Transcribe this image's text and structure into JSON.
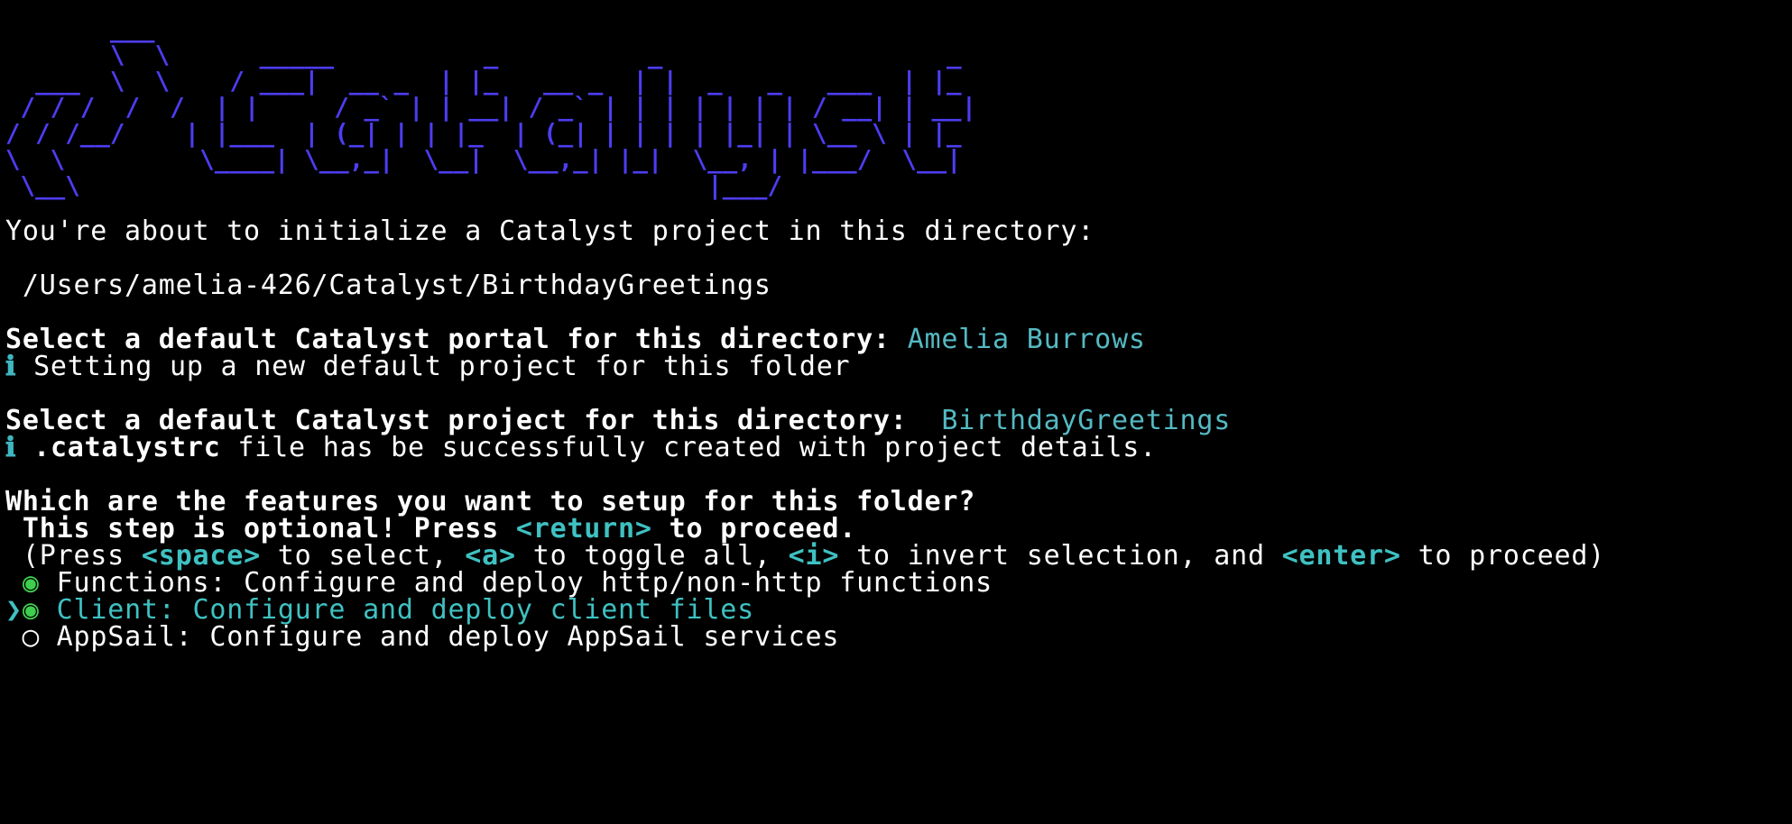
{
  "banner": {
    "art": "       ___\n       \\  \\      _____          _          _                   _\n  ___  \\  \\    / ___|  __ _  | |_   __ _  | |  _   _   ___  | |_\n / / /  /  /  | |     / _` | | __| / _` | | | | | | | / __| | __|\n/ / /__/    | |___  | (_| | | |_  | (_| | | | | |_| | \\__ \\ | |_\n\\  \\         \\____| \\__,_|  \\__|  \\__,_| |_|  \\__, | |___/  \\__|\n \\__\\                                          |___/"
  },
  "intro": {
    "text": "You're about to initialize a Catalyst project in this directory:",
    "path": " /Users/amelia-426/Catalyst/BirthdayGreetings"
  },
  "portal": {
    "question": "Select a default Catalyst portal for this directory:",
    "answer": "Amelia Burrows",
    "info_icon": "ℹ",
    "info_text": " Setting up a new default project for this folder"
  },
  "project": {
    "question": "Select a default Catalyst project for this directory:",
    "answer": "BirthdayGreetings",
    "info_icon": "ℹ",
    "info_file": ".catalystrc",
    "info_text": " file has be successfully created with project details."
  },
  "features": {
    "question": "Which are the features you want to setup for this folder?",
    "optional_prefix": " This step is optional! Press ",
    "optional_key": "<return>",
    "optional_suffix": " to proceed.",
    "help": {
      "p1": " (Press ",
      "k1": "<space>",
      "p2": " to select, ",
      "k2": "<a>",
      "p3": " to toggle all, ",
      "k3": "<i>",
      "p4": " to invert selection, and ",
      "k4": "<enter>",
      "p5": " to proceed)"
    },
    "options": [
      {
        "pointer": " ",
        "marker": "◉",
        "label": "Functions: Configure and deploy http/non-http functions"
      },
      {
        "pointer": "❯",
        "marker": "◉",
        "label": "Client: Configure and deploy client files"
      },
      {
        "pointer": " ",
        "marker": "◯",
        "label": "AppSail: Configure and deploy AppSail services"
      }
    ]
  }
}
